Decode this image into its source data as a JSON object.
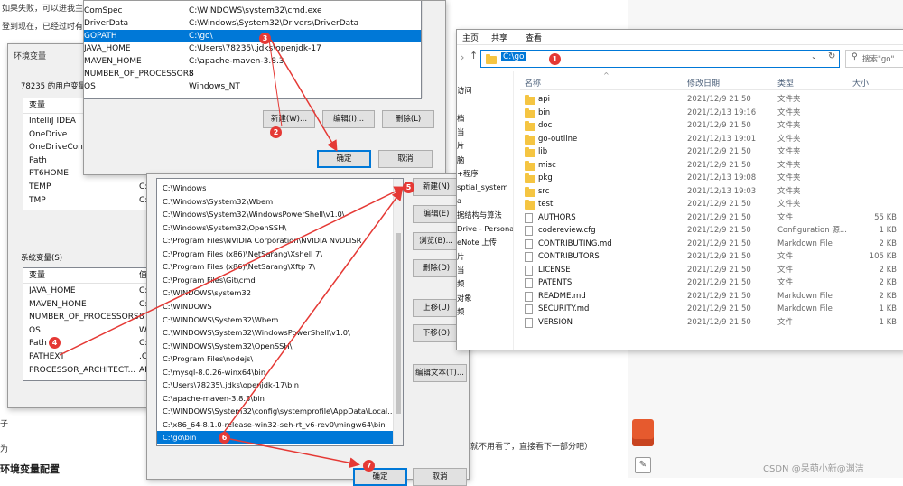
{
  "background": {
    "line1": "如果失败，可以进我主页",
    "line2": "登到现在，已经过时有些",
    "bottom_note": "（就不用看了，直接看下一部分吧）",
    "section_heading": "环境变量配置",
    "left_frag1": "子",
    "left_frag2": "为"
  },
  "user_vars_dialog": {
    "rows": [
      {
        "name": "ComSpec",
        "value": "C:\\WINDOWS\\system32\\cmd.exe"
      },
      {
        "name": "DriverData",
        "value": "C:\\Windows\\System32\\Drivers\\DriverData"
      },
      {
        "name": "GOPATH",
        "value": "C:\\go\\"
      },
      {
        "name": "JAVA_HOME",
        "value": "C:\\Users\\78235\\.jdks\\openjdk-17"
      },
      {
        "name": "MAVEN_HOME",
        "value": "C:\\apache-maven-3.8.3"
      },
      {
        "name": "NUMBER_OF_PROCESSORS",
        "value": "8"
      },
      {
        "name": "OS",
        "value": "Windows_NT"
      }
    ],
    "new_btn": "新建(W)...",
    "edit_btn": "编辑(I)...",
    "delete_btn": "删除(L)",
    "ok_btn": "确定",
    "cancel_btn": "取消"
  },
  "env_dialog": {
    "title": "环境变量",
    "user_section": "78235 的用户变量",
    "col_var": "变量",
    "col_val": "值",
    "user_vars": [
      {
        "name": "IntelliJ IDEA",
        "value": "C:\\"
      },
      {
        "name": "OneDrive",
        "value": "C:\\"
      },
      {
        "name": "OneDriveConsu",
        "value": "C:\\"
      },
      {
        "name": "Path",
        "value": "C:\\"
      },
      {
        "name": "PT6HOME",
        "value": "C:\\"
      },
      {
        "name": "TEMP",
        "value": "C:\\U"
      },
      {
        "name": "TMP",
        "value": "C:\\U"
      }
    ],
    "system_section": "系统变量(S)",
    "system_vars": [
      {
        "name": "JAVA_HOME",
        "value": "C:\\U"
      },
      {
        "name": "MAVEN_HOME",
        "value": "C:\\a"
      },
      {
        "name": "NUMBER_OF_PROCESSORS",
        "value": "8"
      },
      {
        "name": "OS",
        "value": "Win"
      },
      {
        "name": "Path",
        "value": "C:\\F"
      },
      {
        "name": "PATHEXT",
        "value": ".CO"
      },
      {
        "name": "PROCESSOR_ARCHITECT...",
        "value": "AM"
      }
    ]
  },
  "path_dialog": {
    "entries": [
      "C:\\Windows",
      "C:\\Windows\\System32\\Wbem",
      "C:\\Windows\\System32\\WindowsPowerShell\\v1.0\\",
      "C:\\Windows\\System32\\OpenSSH\\",
      "C:\\Program Files\\NVIDIA Corporation\\NVIDIA NvDLISR",
      "C:\\Program Files (x86)\\NetSarang\\Xshell 7\\",
      "C:\\Program Files (x86)\\NetSarang\\Xftp 7\\",
      "C:\\Program Files\\Git\\cmd",
      "C:\\WINDOWS\\system32",
      "C:\\WINDOWS",
      "C:\\WINDOWS\\System32\\Wbem",
      "C:\\WINDOWS\\System32\\WindowsPowerShell\\v1.0\\",
      "C:\\WINDOWS\\System32\\OpenSSH\\",
      "C:\\Program Files\\nodejs\\",
      "C:\\mysql-8.0.26-winx64\\bin",
      "C:\\Users\\78235\\.jdks\\openjdk-17\\bin",
      "C:\\apache-maven-3.8.3\\bin",
      "C:\\WINDOWS\\System32\\config\\systemprofile\\AppData\\Local...",
      "C:\\x86_64-8.1.0-release-win32-seh-rt_v6-rev0\\mingw64\\bin",
      "C:\\go\\bin"
    ],
    "new_btn": "新建(N)",
    "edit_btn": "编辑(E)",
    "browse_btn": "浏览(B)...",
    "delete_btn": "删除(D)",
    "up_btn": "上移(U)",
    "down_btn": "下移(O)",
    "edit_text_btn": "编辑文本(T)...",
    "ok_btn": "确定",
    "cancel_btn": "取消"
  },
  "explorer": {
    "ribbon_tabs": [
      "主页",
      "共享",
      "查看"
    ],
    "address": "C:\\go",
    "search_placeholder": "搜索\"go\"",
    "columns": {
      "name": "名称",
      "date": "修改日期",
      "type": "类型",
      "size": "大小"
    },
    "nav_items": [
      "访问",
      "",
      "档",
      "当",
      "片",
      "脑",
      "+程序",
      "sptial_system",
      "a",
      "据结构与算法",
      "Drive - Personal",
      "eNote 上传",
      "片",
      "当",
      "频",
      "对象",
      "频"
    ],
    "files": [
      {
        "name": "api",
        "date": "2021/12/9 21:50",
        "type": "文件夹",
        "size": "",
        "kind": "folder"
      },
      {
        "name": "bin",
        "date": "2021/12/13 19:16",
        "type": "文件夹",
        "size": "",
        "kind": "folder"
      },
      {
        "name": "doc",
        "date": "2021/12/9 21:50",
        "type": "文件夹",
        "size": "",
        "kind": "folder"
      },
      {
        "name": "go-outline",
        "date": "2021/12/13 19:01",
        "type": "文件夹",
        "size": "",
        "kind": "folder"
      },
      {
        "name": "lib",
        "date": "2021/12/9 21:50",
        "type": "文件夹",
        "size": "",
        "kind": "folder"
      },
      {
        "name": "misc",
        "date": "2021/12/9 21:50",
        "type": "文件夹",
        "size": "",
        "kind": "folder"
      },
      {
        "name": "pkg",
        "date": "2021/12/13 19:08",
        "type": "文件夹",
        "size": "",
        "kind": "folder"
      },
      {
        "name": "src",
        "date": "2021/12/13 19:03",
        "type": "文件夹",
        "size": "",
        "kind": "folder"
      },
      {
        "name": "test",
        "date": "2021/12/9 21:50",
        "type": "文件夹",
        "size": "",
        "kind": "folder"
      },
      {
        "name": "AUTHORS",
        "date": "2021/12/9 21:50",
        "type": "文件",
        "size": "55 KB",
        "kind": "file"
      },
      {
        "name": "codereview.cfg",
        "date": "2021/12/9 21:50",
        "type": "Configuration 源...",
        "size": "1 KB",
        "kind": "file"
      },
      {
        "name": "CONTRIBUTING.md",
        "date": "2021/12/9 21:50",
        "type": "Markdown File",
        "size": "2 KB",
        "kind": "file"
      },
      {
        "name": "CONTRIBUTORS",
        "date": "2021/12/9 21:50",
        "type": "文件",
        "size": "105 KB",
        "kind": "file"
      },
      {
        "name": "LICENSE",
        "date": "2021/12/9 21:50",
        "type": "文件",
        "size": "2 KB",
        "kind": "file"
      },
      {
        "name": "PATENTS",
        "date": "2021/12/9 21:50",
        "type": "文件",
        "size": "2 KB",
        "kind": "file"
      },
      {
        "name": "README.md",
        "date": "2021/12/9 21:50",
        "type": "Markdown File",
        "size": "2 KB",
        "kind": "file"
      },
      {
        "name": "SECURITY.md",
        "date": "2021/12/9 21:50",
        "type": "Markdown File",
        "size": "1 KB",
        "kind": "file"
      },
      {
        "name": "VERSION",
        "date": "2021/12/9 21:50",
        "type": "文件",
        "size": "1 KB",
        "kind": "file"
      }
    ]
  },
  "annotations": {
    "badges": [
      "1",
      "2",
      "3",
      "4",
      "5",
      "6",
      "7"
    ],
    "color": "#e53935"
  },
  "watermark": "CSDN @呆萌小新@渊洁"
}
